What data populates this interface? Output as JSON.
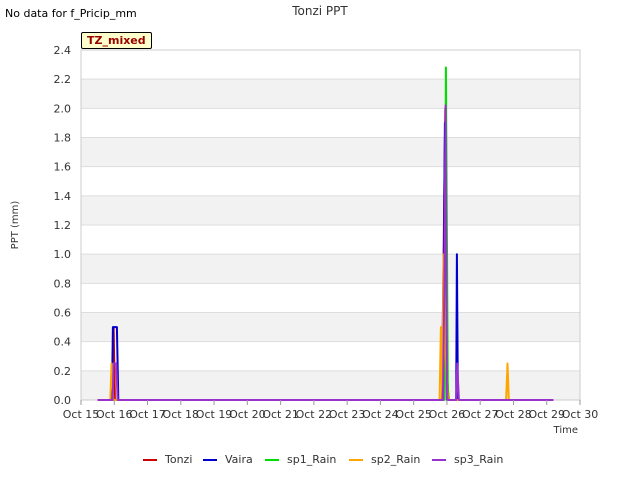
{
  "notice": "No data for f_Pricip_mm",
  "badge": "TZ_mixed",
  "chart_data": {
    "type": "line",
    "title": "Tonzi PPT",
    "xlabel": "Time",
    "ylabel": "PPT (mm)",
    "ylim": [
      0,
      2.4
    ],
    "yticks": [
      "0.0",
      "0.2",
      "0.4",
      "0.6",
      "0.8",
      "1.0",
      "1.2",
      "1.4",
      "1.6",
      "1.8",
      "2.0",
      "2.2",
      "2.4"
    ],
    "xlim": [
      15,
      30
    ],
    "xticks": [
      "Oct 15",
      "Oct 16",
      "Oct 17",
      "Oct 18",
      "Oct 19",
      "Oct 20",
      "Oct 21",
      "Oct 22",
      "Oct 23",
      "Oct 24",
      "Oct 25",
      "Oct 26",
      "Oct 27",
      "Oct 28",
      "Oct 29",
      "Oct 30"
    ],
    "grid": true,
    "legend_position": "bottom",
    "series": [
      {
        "name": "Tonzi",
        "color": "#cc0000",
        "x": [
          15.5,
          15.95,
          15.98,
          16.02,
          25.85,
          25.95,
          26.0,
          26.05,
          29.2
        ],
        "y": [
          0,
          0,
          0.5,
          0,
          0,
          2.0,
          0.2,
          0,
          0
        ]
      },
      {
        "name": "Vaira",
        "color": "#0000cc",
        "x": [
          15.5,
          15.93,
          15.96,
          16.08,
          16.12,
          25.88,
          25.94,
          26.0,
          26.28,
          26.3,
          26.33,
          29.2
        ],
        "y": [
          0,
          0,
          0.5,
          0.5,
          0,
          0,
          1.9,
          0,
          0,
          1.0,
          0,
          0
        ]
      },
      {
        "name": "sp1_Rain",
        "color": "#00dd00",
        "x": [
          15.5,
          25.92,
          25.97,
          26.03,
          29.2
        ],
        "y": [
          0,
          0,
          2.28,
          0,
          0
        ]
      },
      {
        "name": "sp2_Rain",
        "color": "#ffa500",
        "x": [
          15.5,
          15.88,
          15.92,
          15.97,
          25.78,
          25.82,
          25.86,
          25.9,
          25.96,
          26.02,
          27.78,
          27.82,
          27.86,
          29.2
        ],
        "y": [
          0,
          0,
          0.25,
          0,
          0,
          0.5,
          0,
          1.0,
          0.3,
          0,
          0,
          0.25,
          0,
          0
        ]
      },
      {
        "name": "sp3_Rain",
        "color": "#9932cc",
        "x": [
          15.5,
          15.95,
          15.98,
          16.06,
          16.1,
          25.88,
          25.92,
          25.96,
          26.0,
          26.28,
          26.31,
          26.36,
          29.2
        ],
        "y": [
          0,
          0,
          0.25,
          0.25,
          0,
          0,
          0.75,
          2.02,
          0,
          0,
          0.25,
          0,
          0
        ]
      }
    ]
  }
}
